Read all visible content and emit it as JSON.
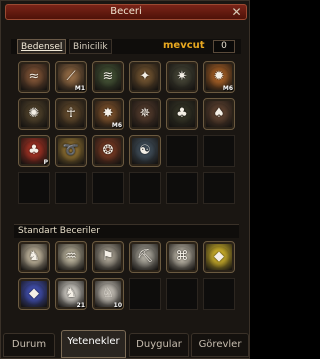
{
  "window": {
    "title": "Beceri"
  },
  "tabs": {
    "bedensel": "Bedensel",
    "binicilik": "Binicilik"
  },
  "points": {
    "label": "mevcut",
    "value": "0"
  },
  "skills": [
    {
      "name": "rope-icon",
      "level": "",
      "color": "#8a5a3a"
    },
    {
      "name": "slash-icon",
      "level": "M1",
      "color": "#9a7048"
    },
    {
      "name": "stripes-icon",
      "level": "",
      "color": "#4a5a3a"
    },
    {
      "name": "blade-icon",
      "level": "",
      "color": "#7a5a34"
    },
    {
      "name": "star-burst-icon",
      "level": "",
      "color": "#4a4a3a"
    },
    {
      "name": "sun-burst-icon",
      "level": "M6",
      "color": "#b86a2a"
    },
    {
      "name": "swirl-icon",
      "level": "",
      "color": "#5a4a30"
    },
    {
      "name": "stickman-icon",
      "level": "",
      "color": "#6a5030"
    },
    {
      "name": "warrior-icon",
      "level": "M6",
      "color": "#8a5a30"
    },
    {
      "name": "spark-icon",
      "level": "",
      "color": "#5a4030"
    },
    {
      "name": "tree-icon",
      "level": "",
      "color": "#3a3a2a"
    },
    {
      "name": "tree-spirit-icon",
      "level": "",
      "color": "#6a4a36"
    },
    {
      "name": "red-tree-icon",
      "level": "P",
      "color": "#b83828"
    },
    {
      "name": "dragon-icon",
      "level": "",
      "color": "#a8843a"
    },
    {
      "name": "fire-swirl-icon",
      "level": "",
      "color": "#8a4228"
    },
    {
      "name": "yin-yang-icon",
      "level": "",
      "color": "#4a5a68"
    }
  ],
  "standard": {
    "title": "Standart Beceriler",
    "skills": [
      {
        "name": "horse-rider-icon",
        "level": "",
        "color": "#d8cbb0"
      },
      {
        "name": "net-icon",
        "level": "",
        "color": "#c8c0a8"
      },
      {
        "name": "flag-icon",
        "level": "",
        "color": "#b8b0a0"
      },
      {
        "name": "pickaxe-icon",
        "level": "",
        "color": "#b8b4a8"
      },
      {
        "name": "knot-icon",
        "level": "",
        "color": "#cfc8b8"
      },
      {
        "name": "yellow-gem-icon",
        "level": "",
        "color": "#e8c830"
      },
      {
        "name": "blue-gem-icon",
        "level": "",
        "color": "#4a5ac8"
      },
      {
        "name": "horse-icon",
        "level": "21",
        "color": "#e6e2da"
      },
      {
        "name": "horse-helmet-icon",
        "level": "10",
        "color": "#d8d2c8"
      }
    ]
  },
  "bottom_tabs": [
    {
      "label": "Durum"
    },
    {
      "label": "Yetenekler"
    },
    {
      "label": "Duygular"
    },
    {
      "label": "Görevler"
    }
  ]
}
